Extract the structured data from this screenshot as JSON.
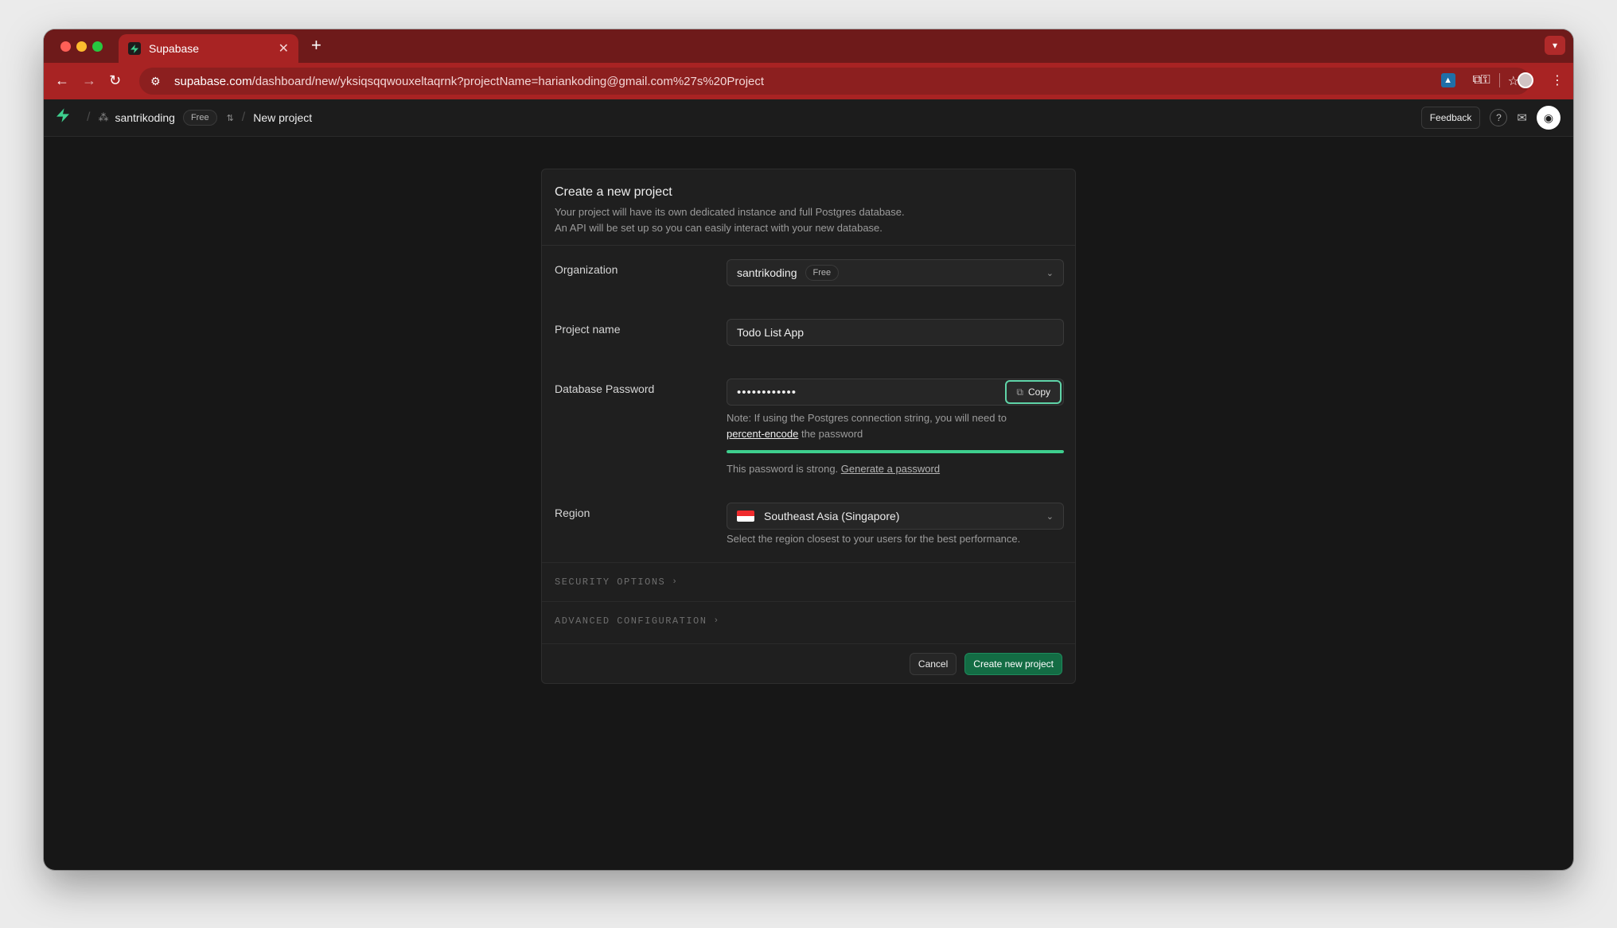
{
  "browser": {
    "tab_title": "Supabase",
    "new_tab": "+",
    "url_host": "supabase.com",
    "url_path": "/dashboard/new/yksiqsqqwouxeltaqrnk?projectName=hariankoding@gmail.com%27s%20Project"
  },
  "header": {
    "org_name": "santrikoding",
    "org_plan": "Free",
    "page_name": "New project",
    "feedback_label": "Feedback"
  },
  "card": {
    "title": "Create a new project",
    "description_line1": "Your project will have its own dedicated instance and full Postgres database.",
    "description_line2": "An API will be set up so you can easily interact with your new database."
  },
  "form": {
    "organization": {
      "label": "Organization",
      "value": "santrikoding",
      "badge": "Free"
    },
    "project_name": {
      "label": "Project name",
      "value": "Todo List App"
    },
    "password": {
      "label": "Database Password",
      "masked_value": "••••••••••••",
      "copy_label": "Copy",
      "note_prefix": "Note: If using the Postgres connection string, you will need to",
      "note_link": "percent-encode",
      "note_suffix": " the password",
      "strength": 1.0,
      "strength_color": "#3ecf8e",
      "strength_text": "This password is strong. ",
      "generate_link": "Generate a password"
    },
    "region": {
      "label": "Region",
      "value": "Southeast Asia (Singapore)",
      "hint": "Select the region closest to your users for the best performance."
    }
  },
  "sections": {
    "security": "SECURITY OPTIONS",
    "advanced": "ADVANCED CONFIGURATION"
  },
  "footer": {
    "cancel_label": "Cancel",
    "create_label": "Create new project"
  },
  "colors": {
    "brand": "#3ecf8e",
    "browser_theme": "#a82323",
    "primary_button": "#136c44"
  }
}
